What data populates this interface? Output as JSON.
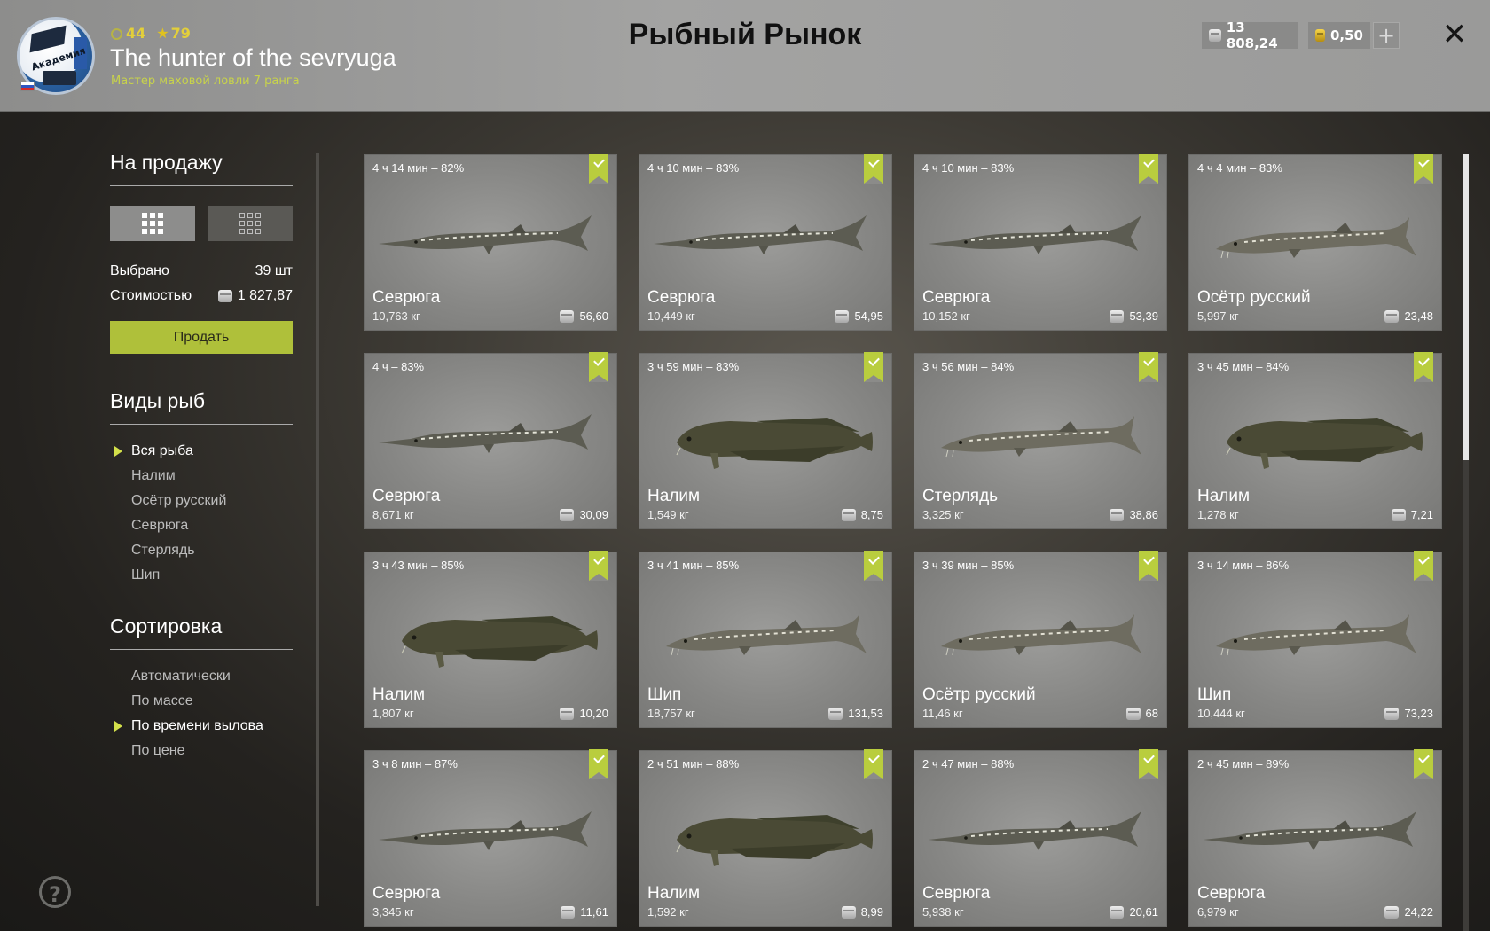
{
  "header": {
    "title": "Рыбный Рынок",
    "player": {
      "name": "The hunter of the sevryuga",
      "rank": "Мастер маховой ловли 7 ранга",
      "level": "44",
      "stars": "79",
      "avatar_label": "Академия"
    },
    "currency": {
      "silver": "13 808,24",
      "gold": "0,50"
    },
    "add_label": "+",
    "close_label": "✕"
  },
  "sidebar": {
    "for_sale_title": "На продажу",
    "selected_label": "Выбрано",
    "selected_value": "39 шт",
    "cost_label": "Стоимостью",
    "cost_value": "1 827,87",
    "sell_button": "Продать",
    "fish_types_title": "Виды рыб",
    "fish_types": [
      {
        "label": "Вся рыба",
        "active": true
      },
      {
        "label": "Налим",
        "active": false
      },
      {
        "label": "Осётр русский",
        "active": false
      },
      {
        "label": "Севрюга",
        "active": false
      },
      {
        "label": "Стерлядь",
        "active": false
      },
      {
        "label": "Шип",
        "active": false
      }
    ],
    "sort_title": "Сортировка",
    "sort_options": [
      {
        "label": "Автоматически",
        "active": false
      },
      {
        "label": "По массе",
        "active": false
      },
      {
        "label": "По времени вылова",
        "active": true
      },
      {
        "label": "По цене",
        "active": false
      }
    ],
    "help_label": "?"
  },
  "colors": {
    "accent": "#afc03a",
    "badge": "#b9cd3e",
    "gold": "#e3cf3a"
  },
  "cards": [
    {
      "time": "4 ч 14 мин – 82%",
      "name": "Севрюга",
      "weight": "10,763 кг",
      "price": "56,60",
      "fish": "sevryuga"
    },
    {
      "time": "4 ч 10 мин – 83%",
      "name": "Севрюга",
      "weight": "10,449 кг",
      "price": "54,95",
      "fish": "sevryuga"
    },
    {
      "time": "4 ч 10 мин – 83%",
      "name": "Севрюга",
      "weight": "10,152 кг",
      "price": "53,39",
      "fish": "sevryuga"
    },
    {
      "time": "4 ч 4 мин – 83%",
      "name": "Осётр русский",
      "weight": "5,997 кг",
      "price": "23,48",
      "fish": "sturgeon"
    },
    {
      "time": "4 ч – 83%",
      "name": "Севрюга",
      "weight": "8,671 кг",
      "price": "30,09",
      "fish": "sevryuga"
    },
    {
      "time": "3 ч 59 мин – 83%",
      "name": "Налим",
      "weight": "1,549 кг",
      "price": "8,75",
      "fish": "burbot"
    },
    {
      "time": "3 ч 56 мин – 84%",
      "name": "Стерлядь",
      "weight": "3,325 кг",
      "price": "38,86",
      "fish": "sterlet"
    },
    {
      "time": "3 ч 45 мин – 84%",
      "name": "Налим",
      "weight": "1,278 кг",
      "price": "7,21",
      "fish": "burbot"
    },
    {
      "time": "3 ч 43 мин – 85%",
      "name": "Налим",
      "weight": "1,807 кг",
      "price": "10,20",
      "fish": "burbot"
    },
    {
      "time": "3 ч 41 мин – 85%",
      "name": "Шип",
      "weight": "18,757 кг",
      "price": "131,53",
      "fish": "sturgeon"
    },
    {
      "time": "3 ч 39 мин – 85%",
      "name": "Осётр русский",
      "weight": "11,46 кг",
      "price": "68",
      "fish": "sturgeon"
    },
    {
      "time": "3 ч 14 мин – 86%",
      "name": "Шип",
      "weight": "10,444 кг",
      "price": "73,23",
      "fish": "sturgeon"
    },
    {
      "time": "3 ч 8 мин – 87%",
      "name": "Севрюга",
      "weight": "3,345 кг",
      "price": "11,61",
      "fish": "sevryuga"
    },
    {
      "time": "2 ч 51 мин – 88%",
      "name": "Налим",
      "weight": "1,592 кг",
      "price": "8,99",
      "fish": "burbot"
    },
    {
      "time": "2 ч 47 мин – 88%",
      "name": "Севрюга",
      "weight": "5,938 кг",
      "price": "20,61",
      "fish": "sevryuga"
    },
    {
      "time": "2 ч 45 мин – 89%",
      "name": "Севрюга",
      "weight": "6,979 кг",
      "price": "24,22",
      "fish": "sevryuga"
    }
  ]
}
